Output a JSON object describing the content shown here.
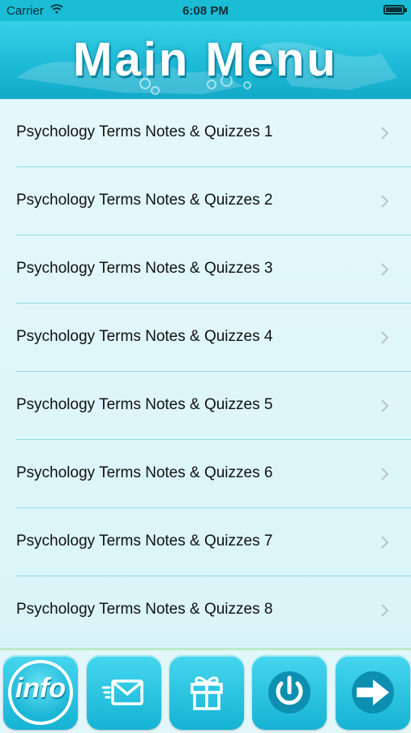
{
  "status_bar": {
    "carrier": "Carrier",
    "time": "6:08 PM"
  },
  "header": {
    "title": "Main Menu"
  },
  "menu": {
    "items": [
      {
        "label": "Psychology Terms Notes & Quizzes 1"
      },
      {
        "label": "Psychology Terms Notes & Quizzes 2"
      },
      {
        "label": "Psychology Terms Notes & Quizzes 3"
      },
      {
        "label": "Psychology Terms Notes & Quizzes 4"
      },
      {
        "label": "Psychology Terms Notes & Quizzes 5"
      },
      {
        "label": "Psychology Terms Notes & Quizzes 6"
      },
      {
        "label": "Psychology Terms Notes & Quizzes 7"
      },
      {
        "label": "Psychology Terms Notes & Quizzes 8"
      }
    ]
  },
  "toolbar": {
    "info_label": "info",
    "icons": [
      "info-icon",
      "mail-icon",
      "gift-icon",
      "power-icon",
      "arrow-right-icon"
    ]
  },
  "colors": {
    "accent": "#1bbcd6",
    "list_background": "#e2f7fa",
    "separator": "#8fdce8"
  }
}
